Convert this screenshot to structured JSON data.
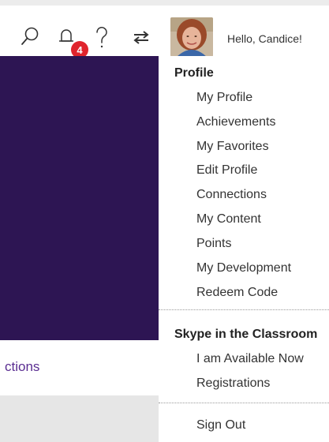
{
  "header": {
    "greeting": "Hello, Candice!",
    "notification_count": "4",
    "icons": [
      "search-icon",
      "bell-icon",
      "help-icon",
      "switch-icon"
    ]
  },
  "page": {
    "link_fragment": "ctions"
  },
  "menu": {
    "profile_heading": "Profile",
    "profile_items": [
      "My Profile",
      "Achievements",
      "My Favorites",
      "Edit Profile",
      "Connections",
      "My Content",
      "Points",
      "My Development",
      "Redeem Code"
    ],
    "skype_heading": "Skype in the Classroom",
    "skype_items": [
      "I am Available Now",
      "Registrations"
    ],
    "sign_out": "Sign Out"
  },
  "colors": {
    "hero": "#2d1553",
    "badge": "#e0242d",
    "link": "#5a2d91"
  }
}
